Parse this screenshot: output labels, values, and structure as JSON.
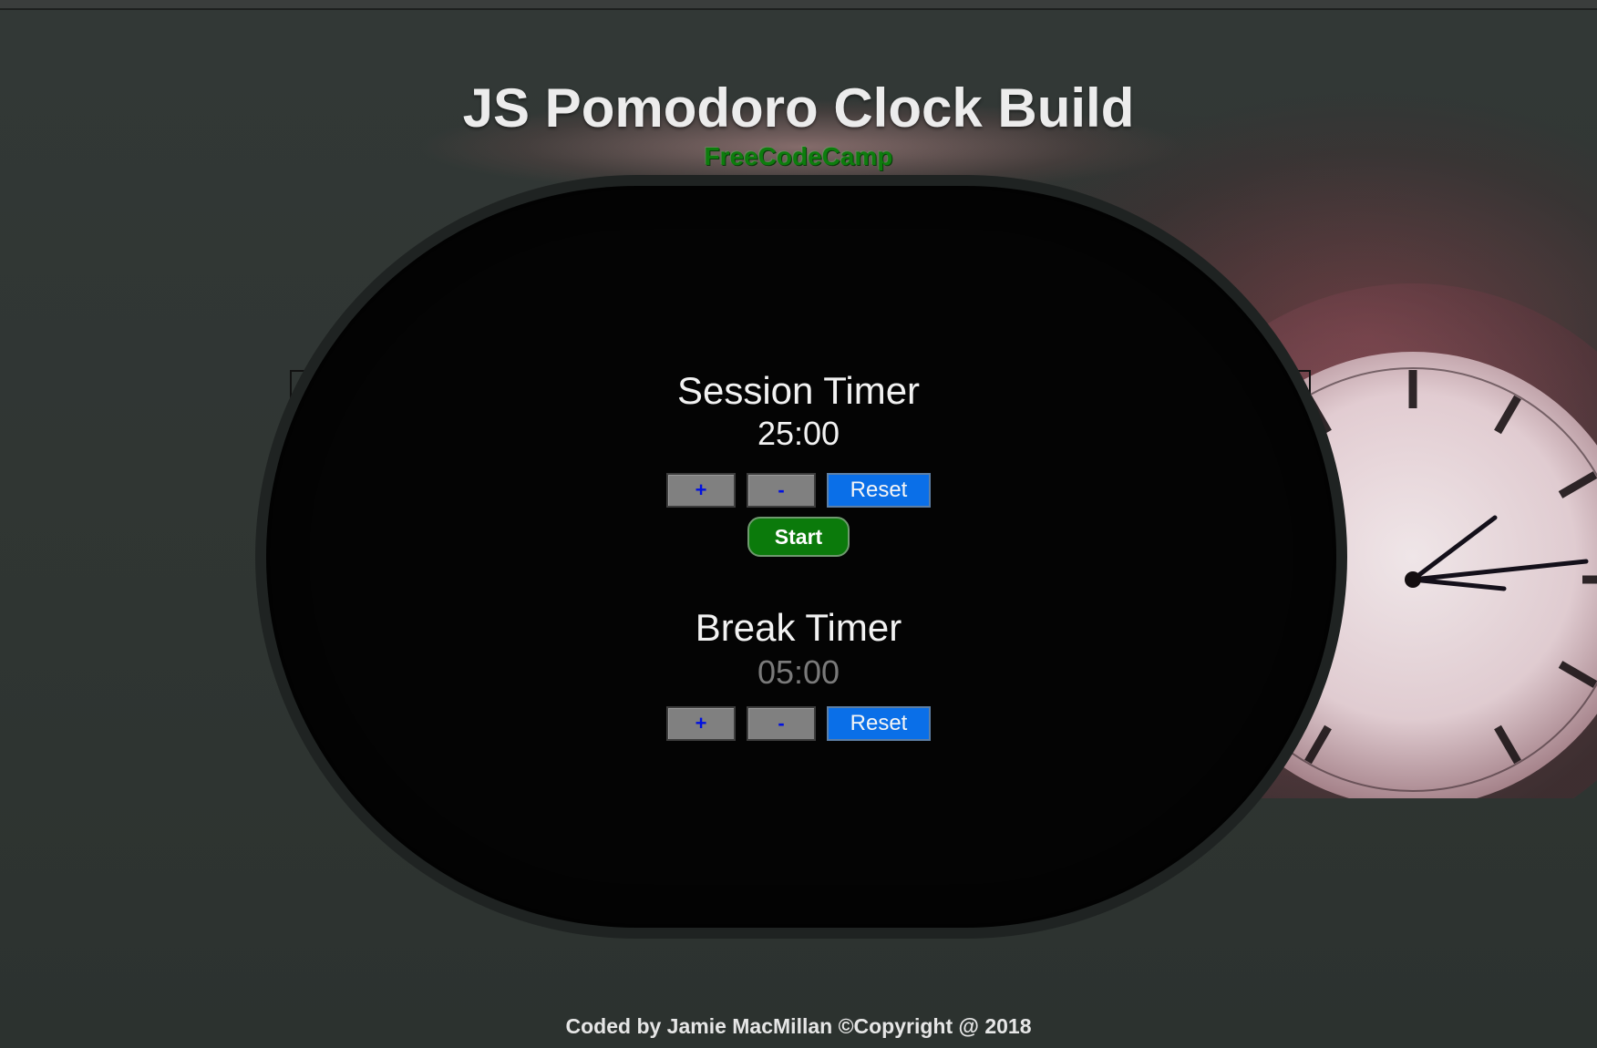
{
  "header": {
    "title": "JS Pomodoro Clock Build",
    "subtitle": "FreeCodeCamp"
  },
  "session": {
    "label": "Session Timer",
    "time": "25:00",
    "increment_label": "+",
    "decrement_label": "-",
    "reset_label": "Reset",
    "start_label": "Start"
  },
  "break": {
    "label": "Break Timer",
    "time": "05:00",
    "increment_label": "+",
    "decrement_label": "-",
    "reset_label": "Reset"
  },
  "footer": {
    "credit": "Coded by Jamie MacMillan ©Copyright @ 2018"
  },
  "colors": {
    "start_button": "#0b7a0b",
    "reset_button": "#0a6fe8",
    "step_button": "#808080",
    "subtitle": "#0d7d0d"
  },
  "background": {
    "image_subject": "vintage wall clock"
  }
}
